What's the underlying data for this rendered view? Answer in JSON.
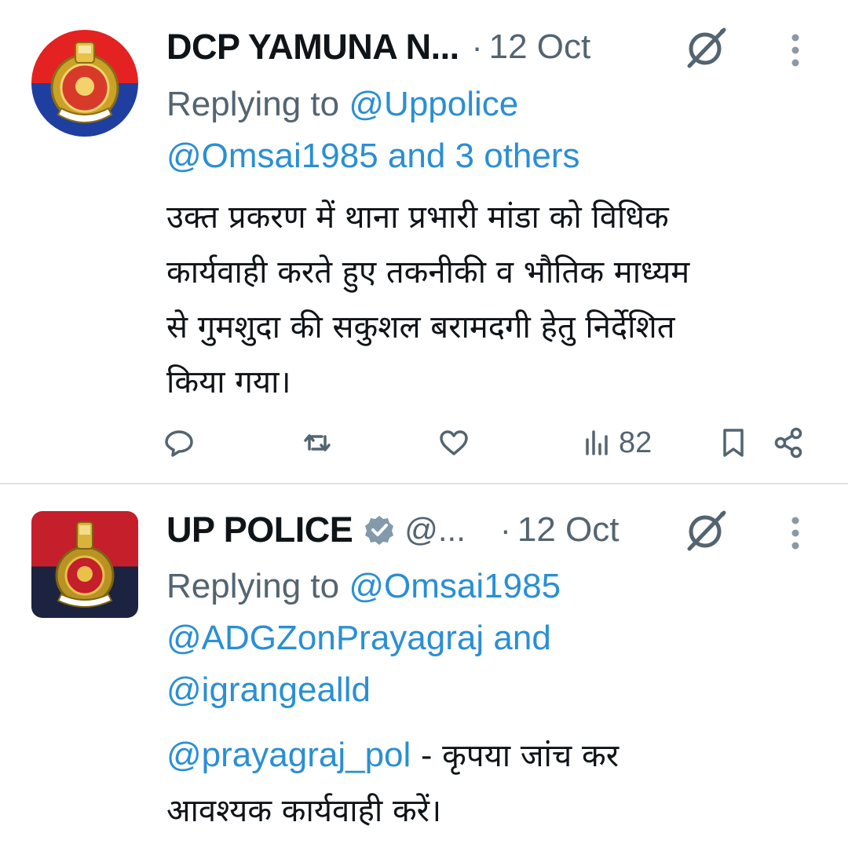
{
  "tweets": [
    {
      "author_name": "DCP YAMUNA N...",
      "separator": "·",
      "date": "12 Oct",
      "replying_prefix": "Replying to",
      "replying_line1_mention": "@Uppolice",
      "replying_line2_mention": "@Omsai1985",
      "replying_line2_rest": " and 3 others",
      "body": [
        "उक्त प्रकरण में थाना प्रभारी मांडा को विधिक",
        "कार्यवाही करते हुए तकनीकी व भौतिक माध्यम",
        "से गुमशुदा की सकुशल बरामदगी हेतु निर्देशित",
        "किया गया।"
      ],
      "views": "82"
    },
    {
      "author_name": "UP POLICE",
      "handle": "@...",
      "separator": "·",
      "date": "12 Oct",
      "replying_prefix": "Replying to",
      "replying_mentions": [
        "@Omsai1985",
        "@ADGZonPrayagraj",
        "@igrangealld"
      ],
      "replying_and": " and",
      "body_mention": "@prayagraj_pol",
      "body_line1_rest": " - कृपया जांच कर",
      "body_line2": "आवश्यक कार्यवाही करें।"
    }
  ],
  "icons": {
    "reply": "reply-icon",
    "retweet": "retweet-icon",
    "like": "heart-icon",
    "views": "views-icon",
    "bookmark": "bookmark-icon",
    "share": "share-icon",
    "grok": "grok-icon",
    "more": "more-icon",
    "verified": "verified-badge-icon"
  },
  "colors": {
    "text": "#0f1419",
    "secondary": "#536471",
    "link": "#2a8fd4",
    "divider": "#dfe3e6"
  }
}
